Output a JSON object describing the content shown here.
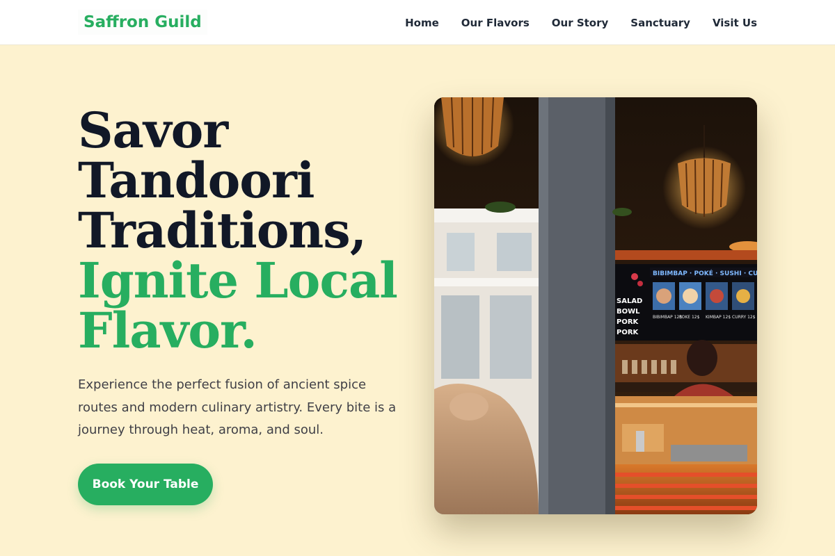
{
  "brand": {
    "name": "Saffron Guild",
    "accent_color": "#27ae60"
  },
  "nav": {
    "items": [
      {
        "label": "Home"
      },
      {
        "label": "Our Flavors"
      },
      {
        "label": "Our Story"
      },
      {
        "label": "Sanctuary"
      },
      {
        "label": "Visit Us"
      }
    ]
  },
  "hero": {
    "title_lines": [
      "Savor",
      "Tandoori",
      "Traditions,"
    ],
    "accent_lines": [
      "Ignite Local",
      "Flavor."
    ],
    "description": "Experience the perfect fusion of ancient spice routes and modern culinary artistry. Every bite is a journey through heat, aroma, and soul.",
    "cta_label": "Book Your Table"
  },
  "image": {
    "menu_board": {
      "header": "BIBIMBAP · POKÉ · SUSHI · CURRY ·",
      "left_lines": [
        "SALAD",
        "BOWL",
        "PORK",
        "PORK"
      ],
      "items": [
        "BIBIMBAP 12$",
        "POKE 12$",
        "KIMBAP 12$",
        "CURRY 12$"
      ]
    }
  }
}
